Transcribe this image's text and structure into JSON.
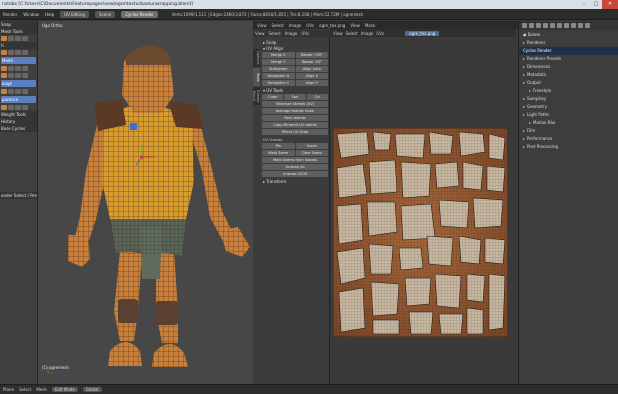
{
  "window": {
    "title": "nstabs [C:\\Users\\C\\Documents\\Featurepages\\new\\ogre\\texturbaa\\unwrapping.blend]",
    "controls": [
      "–",
      "□",
      "✕"
    ]
  },
  "infobar": {
    "menus": [
      "Render",
      "Window",
      "Help"
    ],
    "layout": "UV Editing",
    "scene": "Scene",
    "engine": "Cycles Render",
    "stats": "Verts:1099/1,111 | Edges:2460/3,872 | Faces:8050/1,855 | Tris:8,108 | Mem:52.72M | ogremesh"
  },
  "toolshelf": {
    "items": [
      {
        "label": "Snap",
        "type": "head"
      },
      {
        "label": "Mesh Tools",
        "type": "head"
      },
      {
        "label": "",
        "type": "icons"
      },
      {
        "label": "ti",
        "type": "head"
      },
      {
        "label": "",
        "type": "icons"
      },
      {
        "label": "Mode",
        "type": "sel"
      },
      {
        "label": "",
        "type": "icons"
      },
      {
        "label": "",
        "type": "icons"
      },
      {
        "label": "ange",
        "type": "sel"
      },
      {
        "label": "",
        "type": "icons"
      },
      {
        "label": "parence",
        "type": "sel"
      },
      {
        "label": "",
        "type": "icons"
      },
      {
        "label": "Weight Tools",
        "type": "head"
      },
      {
        "label": "History",
        "type": "head"
      },
      {
        "label": "Base Cycles",
        "type": "head"
      }
    ],
    "footer": "ender Select / Percent"
  },
  "viewport": {
    "label": "Ugo Ortho",
    "object_label": "(1) ogremesh"
  },
  "bottombar": {
    "items": [
      "Plane",
      "Select",
      "Mesh"
    ],
    "mode": "Edit Mode",
    "pivot": "Global"
  },
  "topstrip": {
    "items": [
      "View",
      "Select",
      "Image",
      "UVs",
      "ogre_tex.png",
      "View",
      "Mask"
    ]
  },
  "uvtools": {
    "tabs": [
      "Options",
      "Tools",
      "Grease Pencil"
    ],
    "snap_label": "Snap",
    "uv_align_label": "UV Align",
    "align_buttons": [
      [
        "Merge X",
        "Rotate +90°"
      ],
      [
        "Merge Y",
        "Rotate -90°"
      ],
      [
        "Straighten",
        "Align Auto"
      ],
      [
        "Straighten X",
        "Align X"
      ],
      [
        "Straighten Y",
        "Align Y"
      ]
    ],
    "uv_tools_label": "UV Tools",
    "proj_label": "",
    "proj_buttons": [
      "Cube",
      "Sph",
      "Cyl"
    ],
    "tool_buttons": [
      "Minimize Stretch (UV)",
      "Average Islands Scale",
      "Pack Islands",
      "Copy Mirrored UV coords",
      "Mirror UV Snap"
    ],
    "uv_unwrap_label": "UV Unwrap",
    "unwrap_buttons": [
      "Pin",
      "Unpin"
    ],
    "seam_buttons": [
      "Mark Seam",
      "Clear Seam"
    ],
    "seam_islands": "Mark Seams from Islands",
    "unwrap_all": "Unwrap All",
    "unwrap_lscm": "Unwrap LSCM",
    "transform_label": "Transform"
  },
  "uveditor": {
    "header_items": [
      "View",
      "Select",
      "Image",
      "UVs"
    ],
    "image_name": "ogre_tex.png"
  },
  "properties": {
    "scene_label": "Scene",
    "rows": [
      {
        "label": "Renderer",
        "sel": false
      },
      {
        "label": "Cycles Render",
        "sel": true
      },
      {
        "label": "Renderer Presets",
        "sel": false
      },
      {
        "label": "Dimensions",
        "sel": false
      },
      {
        "label": "Metadata",
        "sel": false
      },
      {
        "label": "Output",
        "sel": false
      },
      {
        "label": "Freestyle",
        "sel": false,
        "sub": true
      },
      {
        "label": "Sampling",
        "sel": false
      },
      {
        "label": "Geometry",
        "sel": false
      },
      {
        "label": "Light Paths",
        "sel": false
      },
      {
        "label": "Motion Blur",
        "sel": false,
        "sub": true
      },
      {
        "label": "Film",
        "sel": false
      },
      {
        "label": "Performance",
        "sel": false
      },
      {
        "label": "Post Processing",
        "sel": false
      }
    ]
  },
  "colors": {
    "skin": "#c9803a",
    "shirt": "#d89c2e",
    "wire": "#3a2410",
    "accent": "#5c7fbf",
    "close": "#c8473c"
  }
}
